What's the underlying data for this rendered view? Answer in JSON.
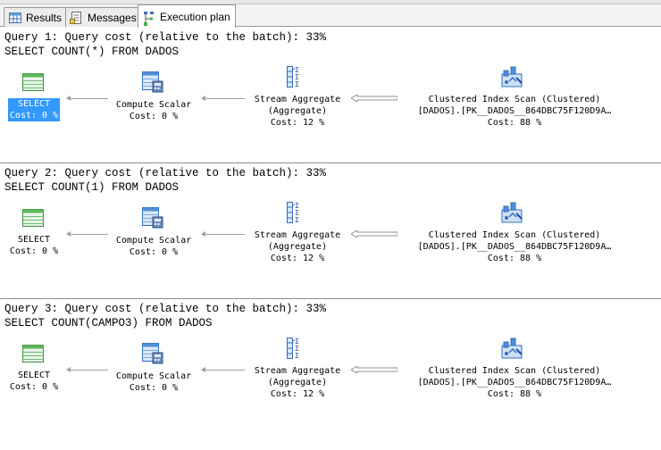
{
  "tabs": [
    {
      "label": "Results",
      "icon": "grid-icon"
    },
    {
      "label": "Messages",
      "icon": "messages-icon"
    },
    {
      "label": "Execution plan",
      "icon": "execution-plan-icon",
      "active": true
    }
  ],
  "queries": [
    {
      "header": "Query 1: Query cost (relative to the batch): 33%",
      "sql": "SELECT COUNT(*) FROM DADOS",
      "select": {
        "name": "SELECT",
        "cost": "Cost: 0 %",
        "selected": true
      },
      "compute": {
        "name": "Compute Scalar",
        "cost": "Cost: 0 %"
      },
      "stream": {
        "name": "Stream Aggregate",
        "sub": "(Aggregate)",
        "cost": "Cost: 12 %"
      },
      "scan": {
        "name": "Clustered Index Scan (Clustered)",
        "object": "[DADOS].[PK__DADOS__864DBC75F120D9A…",
        "cost": "Cost: 88 %"
      }
    },
    {
      "header": "Query 2: Query cost (relative to the batch): 33%",
      "sql": "SELECT COUNT(1) FROM DADOS",
      "select": {
        "name": "SELECT",
        "cost": "Cost: 0 %",
        "selected": false
      },
      "compute": {
        "name": "Compute Scalar",
        "cost": "Cost: 0 %"
      },
      "stream": {
        "name": "Stream Aggregate",
        "sub": "(Aggregate)",
        "cost": "Cost: 12 %"
      },
      "scan": {
        "name": "Clustered Index Scan (Clustered)",
        "object": "[DADOS].[PK__DADOS__864DBC75F120D9A…",
        "cost": "Cost: 88 %"
      }
    },
    {
      "header": "Query 3: Query cost (relative to the batch): 33%",
      "sql": "SELECT COUNT(CAMPO3) FROM DADOS",
      "select": {
        "name": "SELECT",
        "cost": "Cost: 0 %",
        "selected": false
      },
      "compute": {
        "name": "Compute Scalar",
        "cost": "Cost: 0 %"
      },
      "stream": {
        "name": "Stream Aggregate",
        "sub": "(Aggregate)",
        "cost": "Cost: 12 %"
      },
      "scan": {
        "name": "Clustered Index Scan (Clustered)",
        "object": "[DADOS].[PK__DADOS__864DBC75F120D9A…",
        "cost": "Cost: 88 %"
      }
    }
  ],
  "colors": {
    "selection": "#3399ff",
    "icon_blue": "#2f6fbf",
    "icon_green": "#4caf50"
  }
}
